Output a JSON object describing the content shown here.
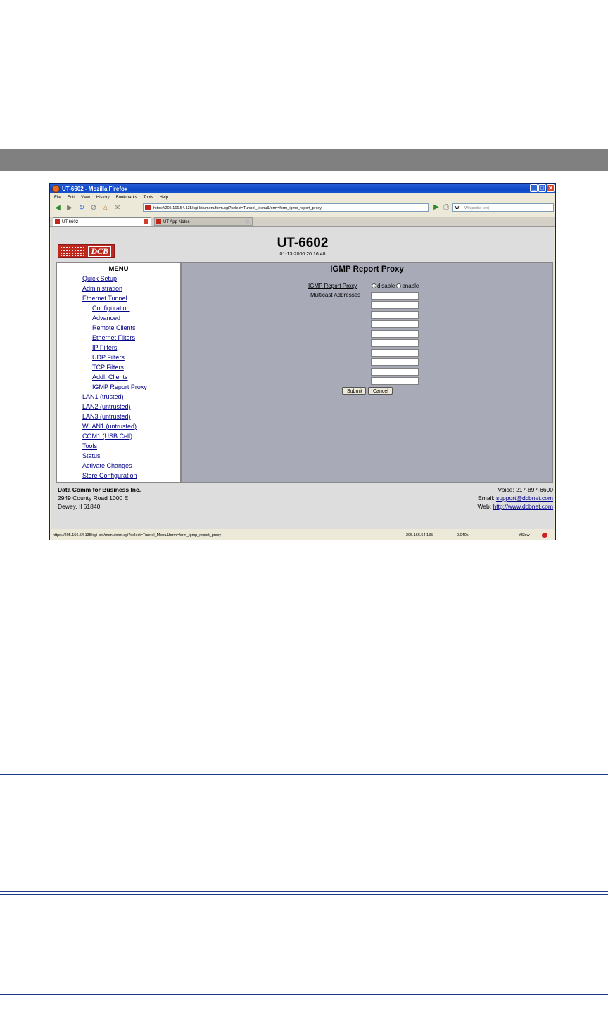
{
  "window": {
    "title": "UT-6602 - Mozilla Firefox"
  },
  "menubar": [
    "File",
    "Edit",
    "View",
    "History",
    "Bookmarks",
    "Tools",
    "Help"
  ],
  "url": "https://205.166.54.135/cgi-bin/menuform.cgi?select=Tunnel_Menu&form=form_igmp_report_proxy",
  "search": {
    "engine": "W",
    "placeholder": "Wikipedia (en)"
  },
  "tabs": [
    {
      "label": "UT-6602",
      "active": true
    },
    {
      "label": "UT App-Notes",
      "active": false
    }
  ],
  "header": {
    "title": "UT-6602",
    "datetime": "01-13-2000 20:16:48",
    "logo_text": "DCB"
  },
  "menu": {
    "title": "MENU",
    "items": [
      {
        "label": "Quick Setup",
        "level": 1
      },
      {
        "label": "Administration",
        "level": 1
      },
      {
        "label": "Ethernet Tunnel",
        "level": 1
      },
      {
        "label": "Configuration",
        "level": 2
      },
      {
        "label": "Advanced",
        "level": 2
      },
      {
        "label": "Remote Clients",
        "level": 2
      },
      {
        "label": "Ethernet Filters",
        "level": 2
      },
      {
        "label": "IP Filters",
        "level": 2
      },
      {
        "label": "UDP Filters",
        "level": 2
      },
      {
        "label": "TCP Filters",
        "level": 2
      },
      {
        "label": "Addl. Clients",
        "level": 2
      },
      {
        "label": "IGMP Report Proxy",
        "level": 2
      },
      {
        "label": "LAN1 (trusted)",
        "level": 1
      },
      {
        "label": "LAN2 (untrusted)",
        "level": 1
      },
      {
        "label": "LAN3 (untrusted)",
        "level": 1
      },
      {
        "label": "WLAN1 (untrusted)",
        "level": 1
      },
      {
        "label": "COM1 (USB Cell)",
        "level": 1
      },
      {
        "label": "Tools",
        "level": 1
      },
      {
        "label": "Status",
        "level": 1
      },
      {
        "label": "Activate Changes",
        "level": 1
      },
      {
        "label": "Store Configuration",
        "level": 1
      }
    ]
  },
  "form": {
    "title": "IGMP Report Proxy",
    "proxy_label": "IGMP Report Proxy",
    "disable_label": "disable",
    "enable_label": "enable",
    "selected": "disable",
    "multicast_label": "Multicast Addresses",
    "addresses": [
      "",
      "",
      "",
      "",
      "",
      "",
      "",
      "",
      "",
      ""
    ],
    "submit": "Submit",
    "cancel": "Cancel"
  },
  "footer": {
    "company": "Data Comm for Business Inc.",
    "address1": "2949 County Road 1000 E",
    "address2": "Dewey, Il 61840",
    "voice": "Voice: 217-897-6600",
    "email_label": "Email: ",
    "email": "support@dcbnet.com",
    "web_label": "Web: ",
    "web": "http://www.dcbnet.com"
  },
  "status": {
    "url": "https://205.166.54.135/cgi-bin/menuform.cgi?select=Tunnel_Menu&form=form_igmp_report_proxy",
    "ip": "205.166.54.135",
    "time": "0.040s",
    "yslow": "YSlow"
  }
}
